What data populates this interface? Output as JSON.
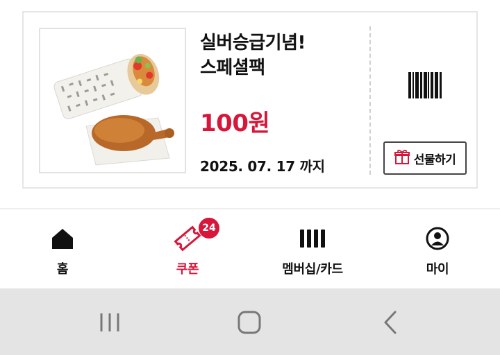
{
  "coupon": {
    "title_line1": "실버승급기념!",
    "title_line2": "스페셜팩",
    "price": "100원",
    "expiry": "2025. 07. 17 까지",
    "gift_label": "선물하기",
    "image_icon": "chicken-wrap-and-drumstick-photo",
    "price_color": "#d6163a"
  },
  "nav": {
    "items": [
      {
        "label": "홈",
        "icon": "home-icon"
      },
      {
        "label": "쿠폰",
        "icon": "coupon-ticket-icon",
        "badge": "24",
        "active": true
      },
      {
        "label": "멤버십/카드",
        "icon": "barcode-icon"
      },
      {
        "label": "마이",
        "icon": "profile-icon"
      }
    ],
    "active_color": "#d6163a"
  },
  "system_nav": {
    "buttons": [
      "recent-apps-icon",
      "home-button-icon",
      "back-icon"
    ]
  }
}
